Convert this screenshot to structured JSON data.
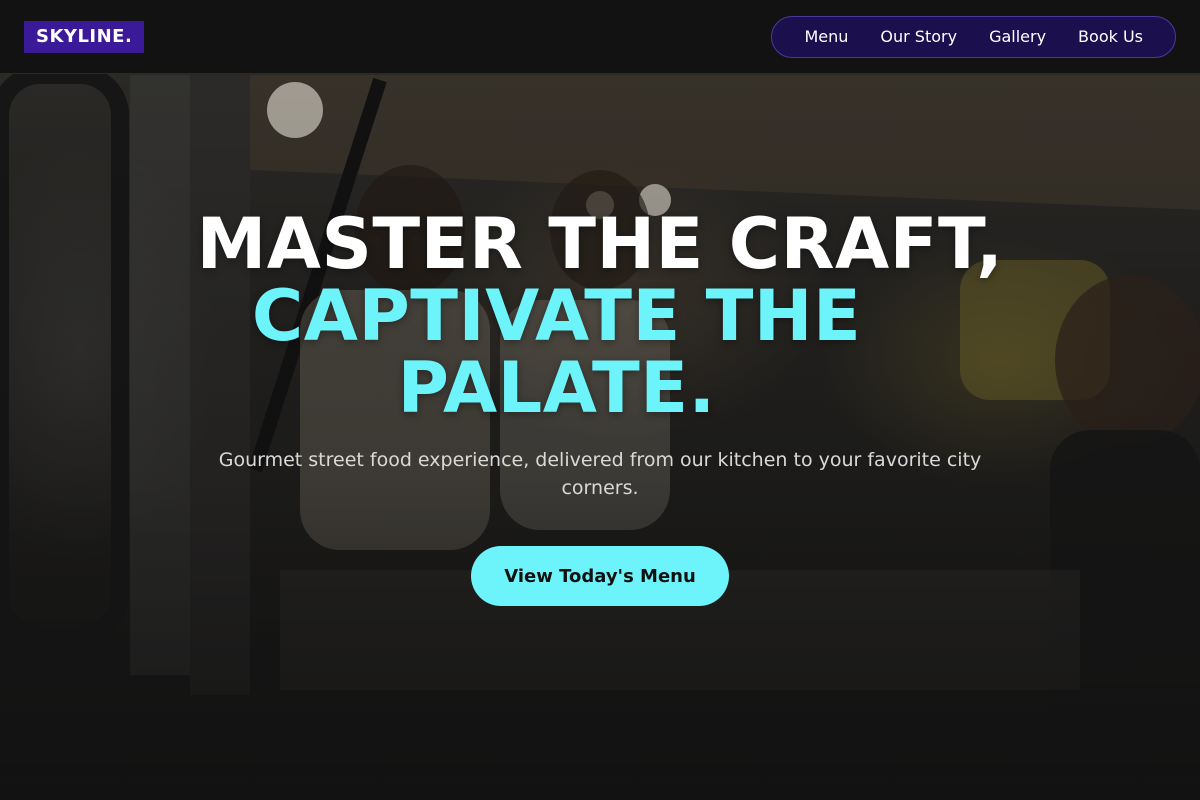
{
  "header": {
    "logo": "SKYLINE.",
    "nav": [
      {
        "label": "Menu"
      },
      {
        "label": "Our Story"
      },
      {
        "label": "Gallery"
      },
      {
        "label": "Book Us"
      }
    ]
  },
  "hero": {
    "headline_line1": "MASTER THE CRAFT,",
    "headline_line2": "CAPTIVATE THE PALATE.",
    "subtext": "Gourmet street food experience, delivered from our kitchen to your favorite city corners.",
    "cta_label": "View Today's Menu"
  },
  "colors": {
    "brand": "#3b1a99",
    "accent": "#6cf4fa",
    "nav_bg": "#1c0f4d",
    "header_bg": "#121212"
  }
}
